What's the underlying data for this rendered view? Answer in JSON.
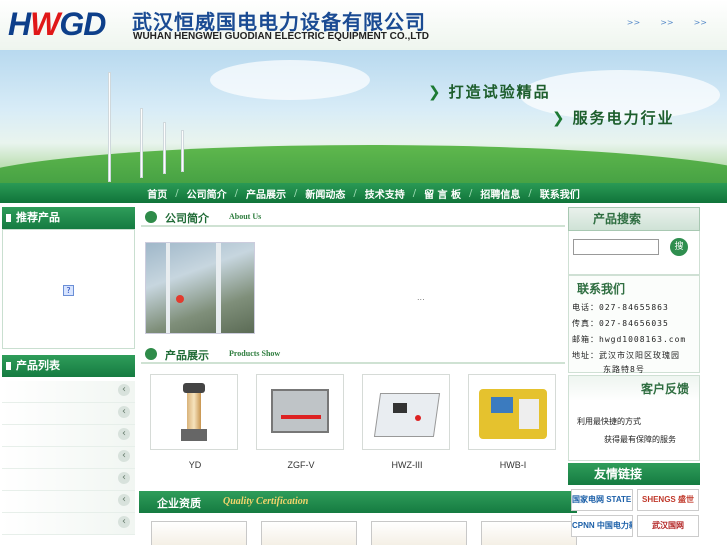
{
  "header": {
    "logo": "HWGD",
    "company_cn": "武汉恒威国电电力设备有限公司",
    "company_en": "WUHAN HENGWEI GUODIAN ELECTRIC EQUIPMENT CO.,LTD",
    "links": [
      ">>",
      ">>",
      ">>"
    ]
  },
  "banner": {
    "slogan1": "打造试验精品",
    "slogan2": "服务电力行业"
  },
  "nav": [
    "首页",
    "公司简介",
    "产品展示",
    "新闻动态",
    "技术支持",
    "留 言 板",
    "招聘信息",
    "联系我们"
  ],
  "left": {
    "recommend_title": "推荐产品",
    "list_title": "产品列表",
    "broken_image": "?"
  },
  "about": {
    "title_cn": "公司简介",
    "title_en": "About Us",
    "more": "..."
  },
  "products": {
    "title_cn": "产品展示",
    "title_en": "Products Show",
    "items": [
      "YD",
      "ZGF-V",
      "HWZ-III",
      "HWB-I"
    ]
  },
  "quality": {
    "title_cn": "企业资质",
    "title_en": "Quality Certification"
  },
  "right": {
    "search_title": "产品搜索",
    "search_btn": "搜",
    "contact_title": "联系我们",
    "phone": "电话：027-84655863",
    "fax": "传真：027-84656035",
    "email": "邮箱：hwgd1008163.com",
    "addr1": "地址：武汉市汉阳区玫瑰园",
    "addr2": "东路特8号",
    "feedback_title": "客户反馈",
    "feedback1": "利用最快捷的方式",
    "feedback2": "获得最有保障的服务",
    "links_title": "友情链接",
    "links": [
      "国家电网 STATE GRID",
      "SHENGS 盛世",
      "CPNN 中国电力新闻网",
      "武汉国网"
    ]
  }
}
